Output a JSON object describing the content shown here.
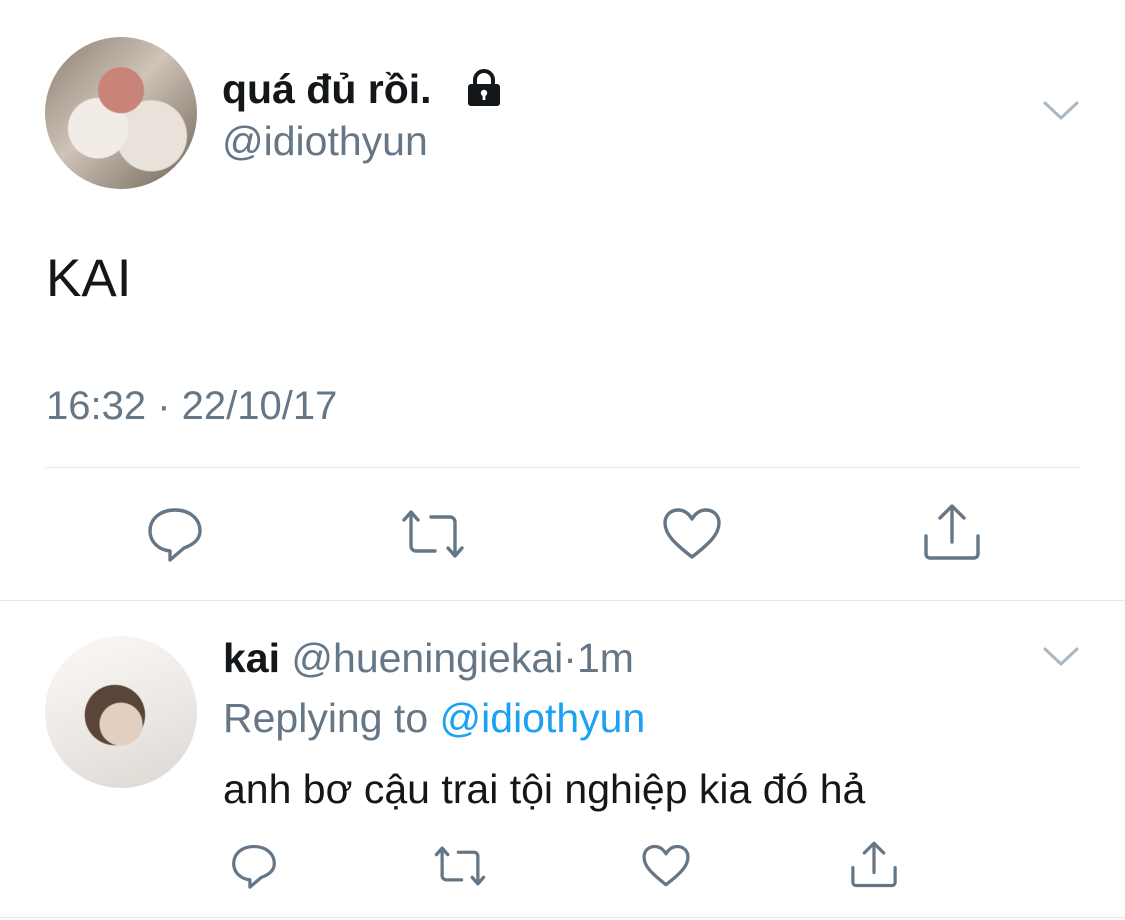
{
  "tweet": {
    "display_name": "quá đủ rồi.",
    "handle": "@idiothyun",
    "text": "KAI",
    "timestamp": "16:32 · 22/10/17",
    "icons": {
      "lock": "lock-icon",
      "menu": "chevron-down-icon"
    },
    "actions": [
      "reply-icon",
      "retweet-icon",
      "like-icon",
      "share-icon"
    ]
  },
  "reply": {
    "display_name": "kai",
    "handle": "@hueningiekai",
    "separator": "·",
    "time": "1m",
    "replying_prefix": "Replying to",
    "replying_handle": "@idiothyun",
    "text": "anh bơ cậu trai tội nghiệp kia đó hả",
    "actions": [
      "reply-icon",
      "retweet-icon",
      "like-icon",
      "share-icon"
    ]
  },
  "colors": {
    "text": "#14171a",
    "secondary": "#657786",
    "accent": "#1da1f2",
    "divider": "#e1e8ed"
  }
}
